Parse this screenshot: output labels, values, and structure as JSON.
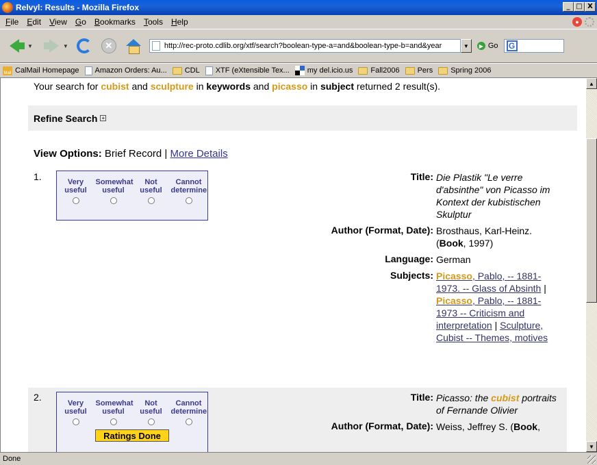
{
  "window": {
    "title": "Relvyl: Results - Mozilla Firefox",
    "controls": [
      "_",
      "□",
      "X"
    ]
  },
  "menu": [
    "File",
    "Edit",
    "View",
    "Go",
    "Bookmarks",
    "Tools",
    "Help"
  ],
  "nav": {
    "url": "http://rec-proto.cdlib.org/xtf/search?boolean-type-a=and&boolean-type-b=and&year",
    "go_label": "Go",
    "search_value": ""
  },
  "bookmarks": [
    {
      "icon": "mail-icon",
      "label": "CalMail Homepage"
    },
    {
      "icon": "page-icon",
      "label": "Amazon Orders: Au..."
    },
    {
      "icon": "folder-icon",
      "label": "CDL"
    },
    {
      "icon": "page-icon",
      "label": "XTF (eXtensible Tex..."
    },
    {
      "icon": "delicious-icon",
      "label": "my del.icio.us"
    },
    {
      "icon": "folder-icon",
      "label": "Fall2006"
    },
    {
      "icon": "folder-icon",
      "label": "Pers"
    },
    {
      "icon": "folder-icon",
      "label": "Spring 2006"
    }
  ],
  "summary": {
    "t1": "Your search for ",
    "k1": "cubist",
    "t2": " and ",
    "k2": "sculpture",
    "t3": " in ",
    "f1": "keywords",
    "t4": " and ",
    "k3": "picasso",
    "t5": " in ",
    "f2": "subject",
    "t6": " returned 2 result(s)."
  },
  "refine": {
    "label": "Refine Search",
    "toggle": "+"
  },
  "view_options": {
    "label": "View Options:",
    "brief": " Brief Record | ",
    "more": "More Details"
  },
  "rating": {
    "options": [
      [
        "Very",
        "useful"
      ],
      [
        "Somewhat",
        "useful"
      ],
      [
        "Not",
        "useful"
      ],
      [
        "Cannot",
        "determine"
      ]
    ],
    "done_label": "Ratings Done"
  },
  "results": [
    {
      "num": "1.",
      "title_label": "Title:",
      "title": "Die Plastik \"Le verre d'absinthe\" von Picasso im Kontext der kubistischen Skulptur",
      "author_label": "Author (Format, Date):",
      "author": "Brosthaus, Karl-Heinz. (",
      "format": "Book",
      "date": ", 1997)",
      "language_label": "Language:",
      "language": "German",
      "subjects_label": "Subjects:",
      "subjects": [
        {
          "hl": "Picasso",
          "rest": ", Pablo, -- 1881-1973. -- Glass of Absinth"
        },
        {
          "hl": "Picasso",
          "rest": ", Pablo, -- 1881-1973 -- Criticism and interpretation"
        },
        {
          "hl": "",
          "rest": "Sculpture, Cubist -- Themes, motives"
        }
      ]
    },
    {
      "num": "2.",
      "title_label": "Title:",
      "title_pre": "Picasso: the ",
      "title_hl": "cubist",
      "title_post": " portraits of Fernande Olivier",
      "author_label": "Author (Format, Date):",
      "author": "Weiss, Jeffrey S. (",
      "format": "Book",
      "date": ","
    }
  ],
  "status": "Done"
}
